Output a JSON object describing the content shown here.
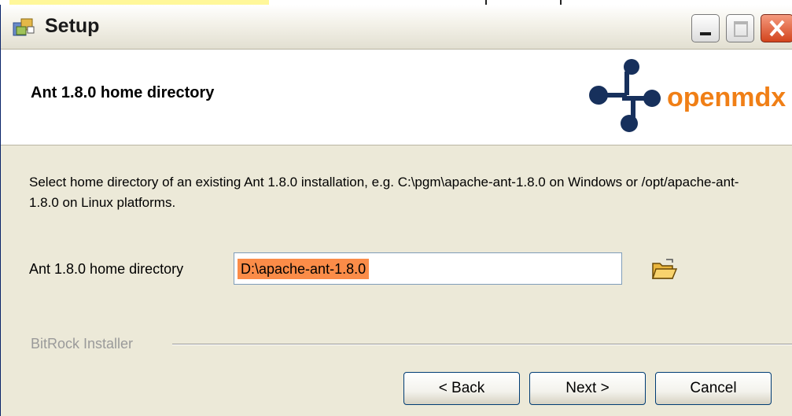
{
  "window": {
    "title": "Setup"
  },
  "header": {
    "title": "Ant 1.8.0 home directory",
    "logo_text": "openmdx",
    "logo_accent_color": "#f07f16",
    "logo_primary_color": "#17305c"
  },
  "content": {
    "description": "Select home directory of an existing Ant 1.8.0 installation, e.g. C:\\pgm\\apache-ant-1.8.0 on Windows or /opt/apache-ant-1.8.0 on Linux platforms.",
    "field_label": "Ant 1.8.0 home directory",
    "field_value": "D:\\apache-ant-1.8.0",
    "browse_icon": "folder-open-icon"
  },
  "footer": {
    "brand": "BitRock Installer",
    "back_label": "< Back",
    "next_label": "Next >",
    "cancel_label": "Cancel"
  },
  "colors": {
    "selection": "#fb8c48",
    "dialog_bg": "#ece9d8"
  }
}
